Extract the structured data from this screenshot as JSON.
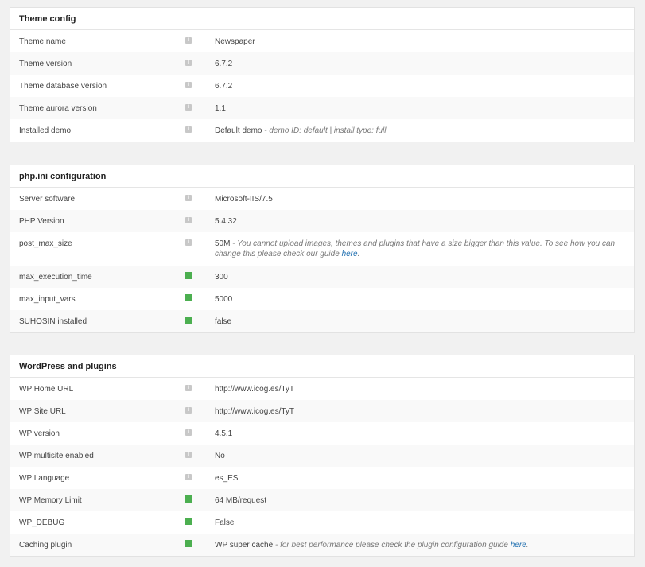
{
  "sections": [
    {
      "title": "Theme config",
      "rows": [
        {
          "label": "Theme name",
          "icon": "info-icon",
          "value": "Newspaper"
        },
        {
          "label": "Theme version",
          "icon": "info-icon",
          "value": "6.7.2"
        },
        {
          "label": "Theme database version",
          "icon": "info-icon",
          "value": "6.7.2"
        },
        {
          "label": "Theme aurora version",
          "icon": "info-icon",
          "value": "1.1"
        },
        {
          "label": "Installed demo",
          "icon": "info-icon",
          "value": "Default demo",
          "note": " - demo ID: default | install type: full"
        }
      ]
    },
    {
      "title": "php.ini configuration",
      "rows": [
        {
          "label": "Server software",
          "icon": "info-icon",
          "value": "Microsoft-IIS/7.5"
        },
        {
          "label": "PHP Version",
          "icon": "info-icon",
          "value": "5.4.32"
        },
        {
          "label": "post_max_size",
          "icon": "info-icon",
          "value": "50M",
          "note": " - You cannot upload images, themes and plugins that have a size bigger than this value. To see how you can change this please check our guide ",
          "link": "here",
          "tail": "."
        },
        {
          "label": "max_execution_time",
          "icon": "status-ok-icon",
          "value": "300"
        },
        {
          "label": "max_input_vars",
          "icon": "status-ok-icon",
          "value": "5000"
        },
        {
          "label": "SUHOSIN installed",
          "icon": "status-ok-icon",
          "value": "false"
        }
      ]
    },
    {
      "title": "WordPress and plugins",
      "rows": [
        {
          "label": "WP Home URL",
          "icon": "info-icon",
          "value": "http://www.icog.es/TyT"
        },
        {
          "label": "WP Site URL",
          "icon": "info-icon",
          "value": "http://www.icog.es/TyT"
        },
        {
          "label": "WP version",
          "icon": "info-icon",
          "value": "4.5.1"
        },
        {
          "label": "WP multisite enabled",
          "icon": "info-icon",
          "value": "No"
        },
        {
          "label": "WP Language",
          "icon": "info-icon",
          "value": "es_ES"
        },
        {
          "label": "WP Memory Limit",
          "icon": "status-ok-icon",
          "value": "64 MB/request"
        },
        {
          "label": "WP_DEBUG",
          "icon": "status-ok-icon",
          "value": "False"
        },
        {
          "label": "Caching plugin",
          "icon": "status-ok-icon",
          "value": "WP super cache",
          "note": " - for best performance please check the plugin configuration guide ",
          "link": "here",
          "tail": "."
        }
      ]
    }
  ],
  "colors": {
    "ok": "#4caf50",
    "info": "#c8c8c8",
    "link": "#2271b1"
  }
}
